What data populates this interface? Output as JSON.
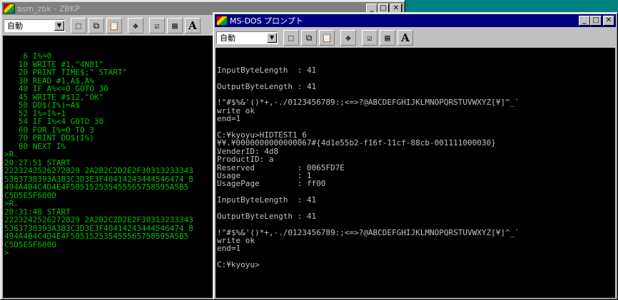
{
  "window1": {
    "title": "asm_zbk - ZBKP",
    "font_select": "自動",
    "lines": [
      "    6 I%=0",
      "   10 WRITE #1,\"4N81\"",
      "   20 PRINT TIME$;\" START\"",
      "   30 READ #1,A$,A%",
      "   40 IF A%<=0 GOTO 30",
      "   45 WRITE #$12,\"OK\"",
      "   50 DD$(I%)=A$",
      "   52 I%=I%+1",
      "   54 IF I%<4 GOTO 30",
      "   60 FOR I%=0 TO 3",
      "   70 PRINT DD$(I%)",
      "   80 NEXT I%",
      ">R.",
      "20:27:51 START",
      "2223242526272829 2A2B2C2D2E2F30313233343",
      "5363738393A3B3C3D3E3F40414243444546474 8",
      "494A4B4C4D4E4F505152535455565758595A5B5",
      "C5D5E5F6000",
      ">R.",
      "20:31:48 START",
      "2223242526272829 2A2B2C2D2E2F30313233343",
      "5363738393A3B3C3D3E3F40414243444546474 8",
      "494A4B4C4D4E4F505152535455565758595A5B5",
      "C5D5E5F6000",
      ">"
    ]
  },
  "window2": {
    "title": "MS-DOS プロンプト",
    "font_select": "自動",
    "lines": [
      "InputByteLength  : 41",
      "",
      "OutputByteLength : 41",
      "",
      "!\"#$%&'()*+,-./0123456789:;<=>?@ABCDEFGHIJKLMNOPQRSTUVWXYZ[¥]^_`",
      "write ok",
      "end=1",
      "",
      "C:¥kyoyu>HIDTEST1_6",
      "¥¥.¥0000000000000067#{4d1e55b2-f16f-11cf-88cb-001111000030}",
      "VenderID: 4d8",
      "ProductID: a",
      "Reserved         : 0065FD7E",
      "Usage            : 1",
      "UsagePage        : ff00",
      "",
      "InputByteLength  : 41",
      "",
      "OutputByteLength : 41",
      "",
      "!\"#$%&'()*+,-./0123456789:;<=>?@ABCDEFGHIJKLMNOPQRSTUVWXYZ[¥]^_`",
      "write ok",
      "end=1",
      "",
      "C:¥kyoyu>"
    ]
  },
  "icons": [
    "app-icon",
    "mark-icon",
    "copy-icon",
    "paste-icon",
    "fullscreen-icon",
    "properties-icon",
    "background-icon",
    "font-icon",
    "minimize-icon",
    "maximize-icon",
    "close-icon"
  ]
}
